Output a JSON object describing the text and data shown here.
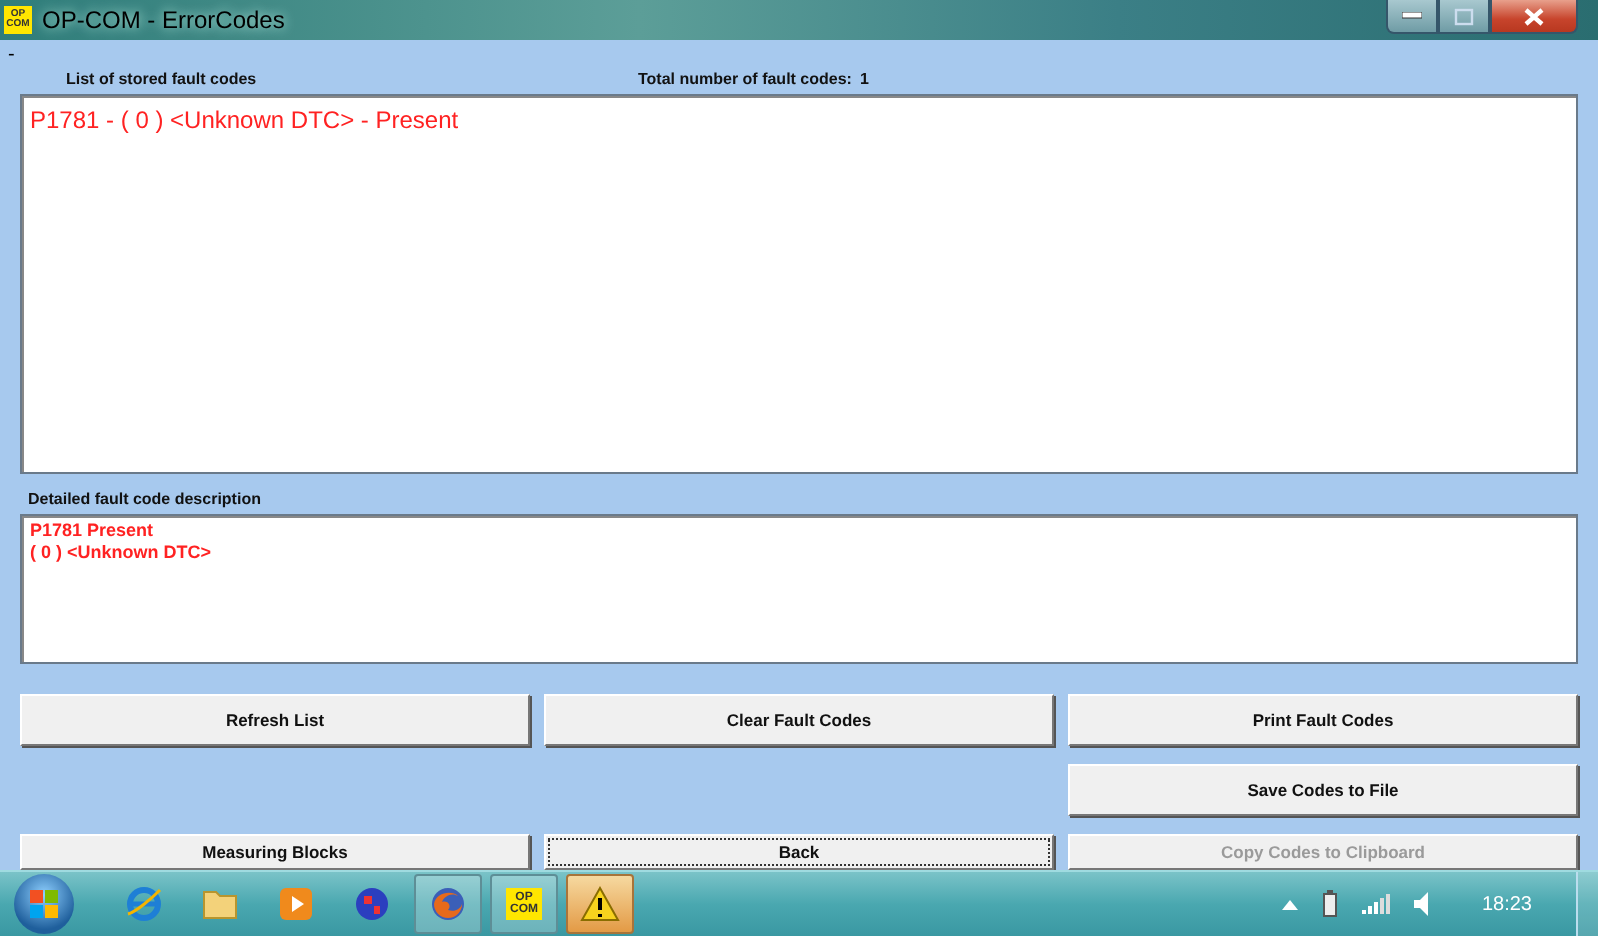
{
  "window": {
    "title": "OP-COM - ErrorCodes",
    "icon_lines": [
      "OP",
      "COM"
    ]
  },
  "marker": "-",
  "list_label": "List of stored fault codes",
  "total_label": "Total number of fault codes:",
  "total_value": "1",
  "fault_list": [
    "P1781 - ( 0 )  <Unknown DTC> - Present"
  ],
  "description_label": "Detailed fault code description",
  "description_lines": [
    "P1781  Present",
    "( 0 )  <Unknown DTC>"
  ],
  "button_rows": [
    [
      {
        "label": "Refresh List",
        "disabled": false,
        "focused": false
      },
      {
        "label": "Clear Fault Codes",
        "disabled": false,
        "focused": false
      },
      {
        "label": "Print Fault Codes",
        "disabled": false,
        "focused": false
      }
    ],
    [
      {
        "label": "Save Codes to File",
        "disabled": false,
        "focused": false
      }
    ],
    [
      {
        "label": "Measuring Blocks",
        "disabled": false,
        "focused": false
      },
      {
        "label": "Back",
        "disabled": false,
        "focused": true
      },
      {
        "label": "Copy Codes to Clipboard",
        "disabled": true,
        "focused": false
      }
    ]
  ],
  "taskbar": {
    "apps": [
      {
        "running": false
      },
      {
        "running": false
      },
      {
        "running": false
      },
      {
        "running": false
      },
      {
        "running": true
      },
      {
        "running": true,
        "icon_lines": [
          "OP",
          "COM"
        ]
      },
      {
        "running": true,
        "active": true
      }
    ],
    "clock": "18:23"
  }
}
